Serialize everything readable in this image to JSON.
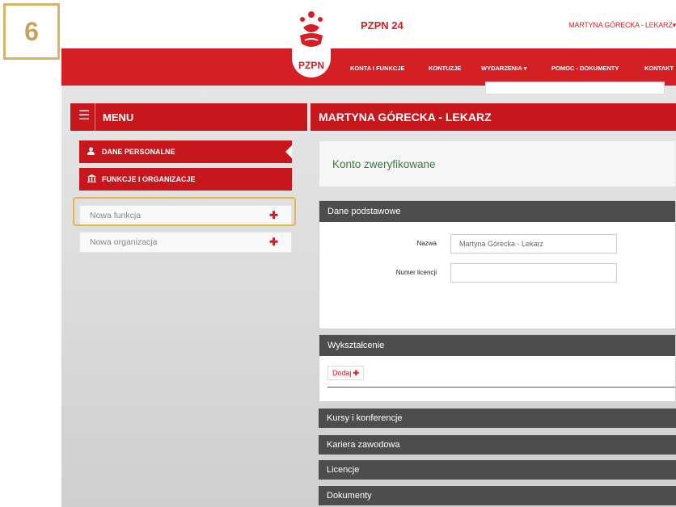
{
  "step": {
    "number": "6"
  },
  "header": {
    "brand": "PZPN 24",
    "logo_text": "PZPN",
    "user": "MARTYNA GÓRECKA - LEKARZ",
    "nav": [
      "KONTA I FUNKCJE",
      "KONTUZJE",
      "WYDARZENIA",
      "POMOC - DOKUMENTY",
      "KONTAKT"
    ]
  },
  "sidebar": {
    "title": "MENU",
    "items": [
      {
        "label": "DANE PERSONALNE"
      },
      {
        "label": "FUNKCJE I ORGANIZACJE"
      }
    ],
    "actions": [
      {
        "label": "Nowa funkcja"
      },
      {
        "label": "Nowa organizacja"
      }
    ]
  },
  "main": {
    "title": "MARTYNA GÓRECKA - LEKARZ",
    "status": "Konto zweryfikowane",
    "sections": {
      "basic": {
        "title": "Dane podstawowe",
        "name_label": "Nazwa",
        "name_value": "Martyna Górecka - Lekarz",
        "license_label": "Numer licencji",
        "license_value": ""
      },
      "education": {
        "title": "Wykształcenie",
        "add_label": "Dodaj"
      },
      "collapsed": [
        "Kursy i konferencje",
        "Kariera zawodowa",
        "Licencje",
        "Dokumenty"
      ]
    }
  },
  "colors": {
    "brand_red": "#d41f25",
    "dark_bar": "#4d4d4d",
    "highlight": "#e7b64f"
  },
  "icons": [
    "hamburger-icon",
    "user-icon",
    "building-icon",
    "plus-icon",
    "chevron-down-icon"
  ]
}
